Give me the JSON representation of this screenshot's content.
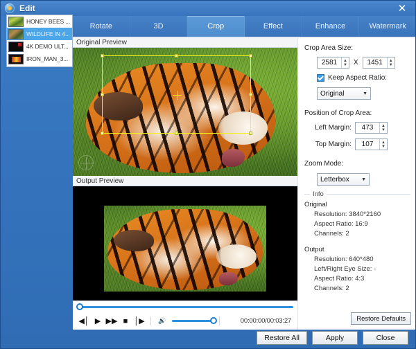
{
  "window": {
    "title": "Edit",
    "app_icon": "app-logo-icon",
    "close_label": "✕"
  },
  "filelist": {
    "items": [
      {
        "name": "HONEY BEES ...",
        "thumb": "thumb-honeybees",
        "selected": false
      },
      {
        "name": "WILDLIFE IN 4...",
        "thumb": "thumb-wildlife",
        "selected": true
      },
      {
        "name": "4K DEMO ULT...",
        "thumb": "thumb-4kdemo",
        "selected": false
      },
      {
        "name": "IRON_MAN_3...",
        "thumb": "thumb-ironman",
        "selected": false
      }
    ]
  },
  "tabs": [
    {
      "label": "Rotate",
      "active": false
    },
    {
      "label": "3D",
      "active": false
    },
    {
      "label": "Crop",
      "active": true
    },
    {
      "label": "Effect",
      "active": false
    },
    {
      "label": "Enhance",
      "active": false
    },
    {
      "label": "Watermark",
      "active": false
    }
  ],
  "previews": {
    "original_header": "Original Preview",
    "output_header": "Output Preview"
  },
  "settings": {
    "crop_area_size_label": "Crop Area Size:",
    "crop_width": "2581",
    "crop_height": "1451",
    "size_separator": "X",
    "keep_aspect_ratio_label": "Keep Aspect Ratio:",
    "keep_aspect_ratio_checked": true,
    "aspect_ratio_value": "Original",
    "position_label": "Position of Crop Area:",
    "left_margin_label": "Left Margin:",
    "left_margin_value": "473",
    "top_margin_label": "Top Margin:",
    "top_margin_value": "107",
    "zoom_mode_label": "Zoom Mode:",
    "zoom_mode_value": "Letterbox"
  },
  "info": {
    "caption": "Info",
    "original_label": "Original",
    "original_lines": [
      "Resolution: 3840*2160",
      "Aspect Ratio: 16:9",
      "Channels: 2"
    ],
    "output_label": "Output",
    "output_lines": [
      "Resolution: 640*480",
      "Left/Right Eye Size: -",
      "Aspect Ratio: 4:3",
      "Channels: 2"
    ]
  },
  "transport": {
    "prev_icon": "◀│",
    "play_icon": "▶",
    "forward_icon": "▶▶",
    "stop_icon": "■",
    "next_icon": "│▶",
    "volume_icon": "🔊",
    "timecode": "00:00:00/00:03:27",
    "seek_position_percent": 0,
    "volume_percent": 100
  },
  "buttons": {
    "restore_defaults": "Restore Defaults",
    "restore_all": "Restore All",
    "apply": "Apply",
    "close": "Close"
  },
  "colors": {
    "titlebar": "#3874bd",
    "accent": "#2d8fe0",
    "tab_active": "#5c9ad8",
    "selection": "#4da6e8",
    "crop_outline": "#f2f21a"
  }
}
